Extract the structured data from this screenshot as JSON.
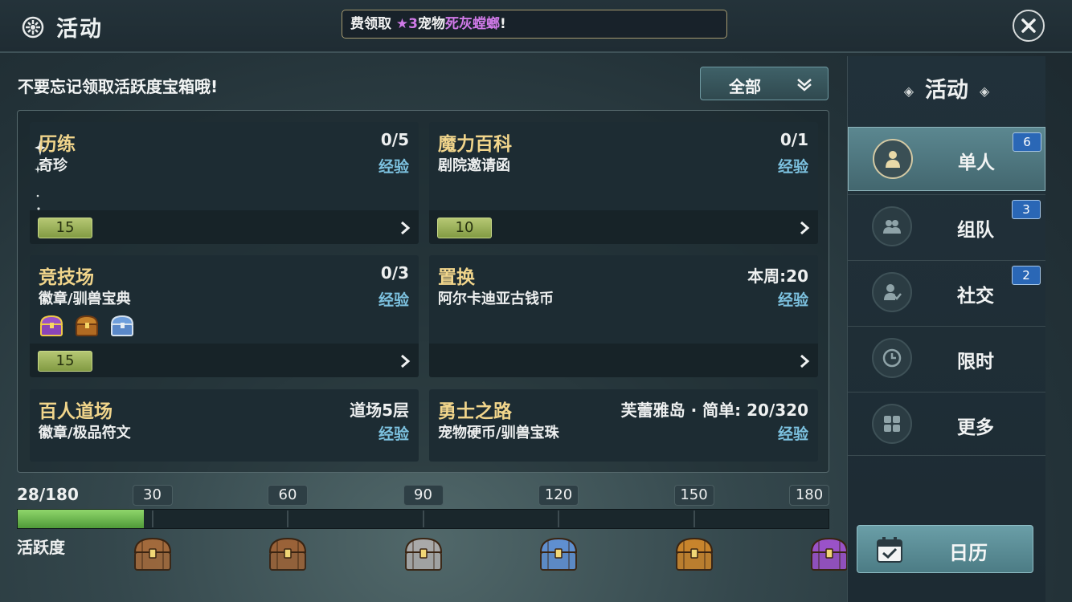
{
  "header": {
    "title": "活动",
    "notice_prefix": "费领取",
    "notice_star": "★3",
    "notice_middle": "宠物",
    "notice_pet": "死灰螳螂",
    "notice_suffix": "!"
  },
  "reminder": "不要忘记领取活跃度宝箱哦!",
  "filter": {
    "selected": "全部"
  },
  "cards": [
    {
      "name": "历练",
      "progress": "0/5",
      "reward": "奇珍",
      "exp": "经验",
      "badge": "15"
    },
    {
      "name": "魔力百科",
      "progress": "0/1",
      "reward": "剧院邀请函",
      "exp": "经验",
      "badge": "10"
    },
    {
      "name": "竞技场",
      "progress": "0/3",
      "reward": "徽章/驯兽宝典",
      "exp": "经验",
      "badge": "15"
    },
    {
      "name": "置换",
      "progress": "本周:20",
      "reward": "阿尔卡迪亚古钱币",
      "exp": "经验",
      "badge": ""
    },
    {
      "name": "百人道场",
      "progress": "道场5层",
      "reward": "徽章/极品符文",
      "exp": "经验"
    },
    {
      "name": "勇士之路",
      "progress": "芙蕾雅岛 · 简单: 20/320",
      "reward": "宠物硬币/驯兽宝珠",
      "exp": "经验"
    }
  ],
  "activity": {
    "label": "活跃度",
    "score": "28/180",
    "current": 28,
    "max": 180,
    "milestones": [
      "30",
      "60",
      "90",
      "120",
      "150",
      "180"
    ],
    "chest_colors": [
      "#a26a3c",
      "#9a6238",
      "#a9a9a9",
      "#5f8fd0",
      "#c8842c",
      "#9a52c8"
    ]
  },
  "sidebar": {
    "title": "活动",
    "items": [
      {
        "label": "单人",
        "count": "6",
        "icon": "person-icon",
        "active": true
      },
      {
        "label": "组队",
        "count": "3",
        "icon": "group-icon",
        "active": false
      },
      {
        "label": "社交",
        "count": "2",
        "icon": "social-icon",
        "active": false
      },
      {
        "label": "限时",
        "count": "",
        "icon": "clock-icon",
        "active": false
      },
      {
        "label": "更多",
        "count": "",
        "icon": "grid-icon",
        "active": false
      }
    ],
    "calendar_label": "日历"
  }
}
